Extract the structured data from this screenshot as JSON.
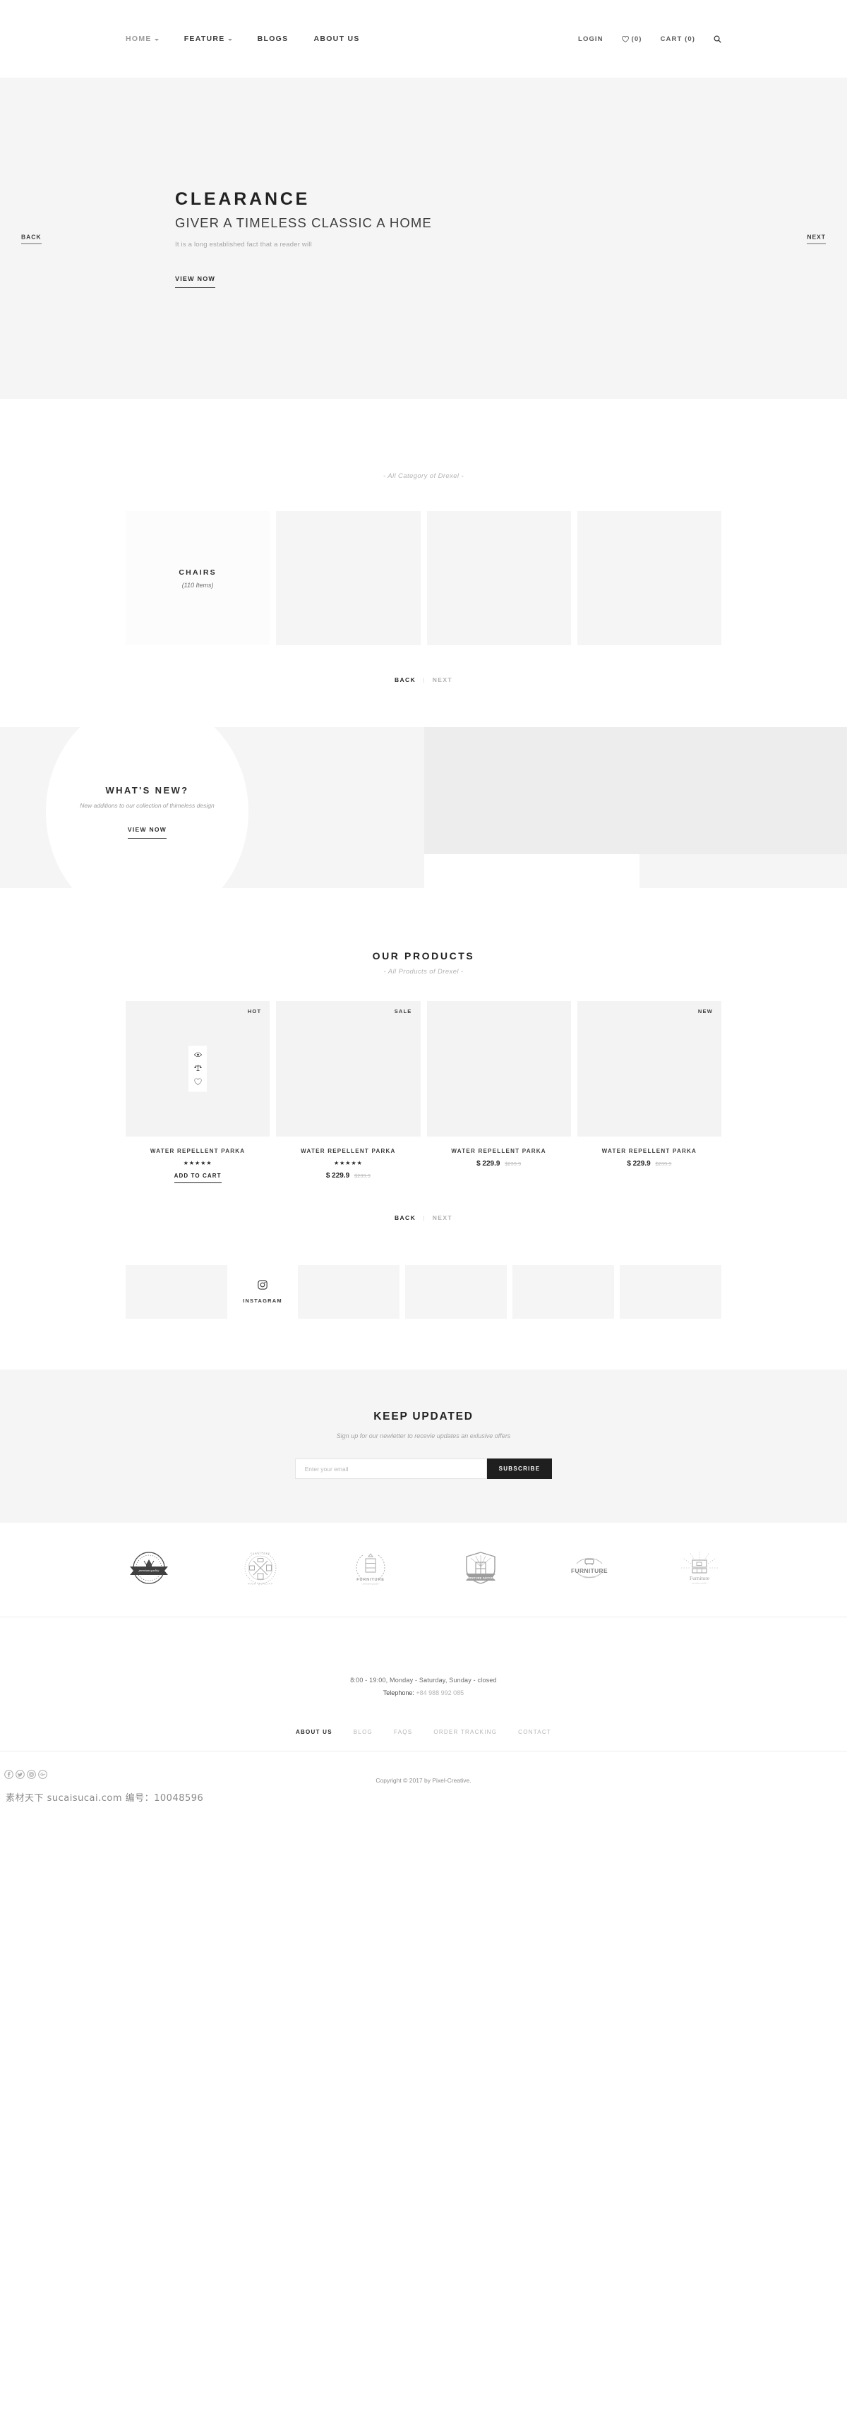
{
  "header": {
    "nav": [
      {
        "label": "HOME",
        "has_caret": true,
        "muted": true
      },
      {
        "label": "FEATURE",
        "has_caret": true,
        "muted": false
      },
      {
        "label": "BLOGS",
        "has_caret": false,
        "muted": false
      },
      {
        "label": "ABOUT US",
        "has_caret": false,
        "muted": false
      }
    ],
    "login_label": "LOGIN",
    "wishlist_count": "(0)",
    "cart_label": "CART (0)",
    "search_icon": "search-icon",
    "wishlist_icon": "heart-icon"
  },
  "hero": {
    "title": "CLEARANCE",
    "subtitle": "GIVER A TIMELESS CLASSIC A HOME",
    "description": "It is a long established fact that a reader will",
    "cta": "VIEW NOW",
    "back": "BACK",
    "next": "NEXT"
  },
  "categories": {
    "eyebrow": "- All Category of Drexel -",
    "cards": [
      {
        "name": "CHAIRS",
        "count": "(110 Items)",
        "active": true
      },
      {
        "name": "",
        "count": "",
        "active": false
      },
      {
        "name": "",
        "count": "",
        "active": false
      },
      {
        "name": "",
        "count": "",
        "active": false
      }
    ],
    "pager": {
      "back": "BACK",
      "sep": "|",
      "next": "NEXT"
    }
  },
  "whats_new": {
    "title": "WHAT'S NEW?",
    "subtitle": "New additions to our collection of thimeless design",
    "cta": "VIEW NOW"
  },
  "products": {
    "title": "OUR PRODUCTS",
    "eyebrow": "- All Products of Drexel -",
    "items": [
      {
        "badge": "HOT",
        "name": "WATER REPELLENT PARKA",
        "stars": "★★★★★",
        "price": "",
        "price_old": "",
        "add_to_cart": "ADD TO CART",
        "show_actions": true,
        "actions": [
          "eye-icon",
          "compare-icon",
          "heart-icon"
        ]
      },
      {
        "badge": "SALE",
        "name": "WATER REPELLENT PARKA",
        "stars": "★★★★★",
        "price": "$ 229.9",
        "price_old": "$239.9",
        "add_to_cart": "",
        "show_actions": false,
        "actions": []
      },
      {
        "badge": "",
        "name": "WATER REPELLENT PARKA",
        "stars": "",
        "price": "$ 229.9",
        "price_old": "$239.9",
        "add_to_cart": "",
        "show_actions": false,
        "actions": []
      },
      {
        "badge": "NEW",
        "name": "WATER REPELLENT PARKA",
        "stars": "",
        "price": "$ 229.9",
        "price_old": "$239.9",
        "add_to_cart": "",
        "show_actions": false,
        "actions": []
      }
    ],
    "pager": {
      "back": "BACK",
      "sep": "|",
      "next": "NEXT"
    }
  },
  "instagram": {
    "label": "INSTAGRAM",
    "icon": "instagram-icon",
    "tiles": 5
  },
  "newsletter": {
    "title": "KEEP UPDATED",
    "subtitle": "Sign up for our newletter to recevie updates an exlusive offers",
    "placeholder": "Enter your email",
    "value": "",
    "button": "SUBSCRIBE"
  },
  "brands": [
    {
      "name": "brand-premium-quality-badge"
    },
    {
      "name": "brand-furniture-high-quality-badge"
    },
    {
      "name": "brand-furniture-premium-quality-wreath"
    },
    {
      "name": "brand-furniture-factory-shield"
    },
    {
      "name": "brand-furniture-high-quality-circle"
    },
    {
      "name": "brand-furniture-premium-quality-sunburst"
    }
  ],
  "footer": {
    "hours": "8:00 - 19:00, Monday - Saturday, Sunday - closed",
    "telephone_label": "Telephone:",
    "telephone_number": "+84 988 992 085",
    "links": [
      {
        "label": "ABOUT US",
        "active": true
      },
      {
        "label": "BLOG",
        "active": false
      },
      {
        "label": "FAQS",
        "active": false
      },
      {
        "label": "ORDER TRACKING",
        "active": false
      },
      {
        "label": "CONTACT",
        "active": false
      }
    ],
    "copyright": "Copyright © 2017 by Pixel-Creative."
  },
  "watermark": "素材天下 sucaisucai.com  编号：10048596",
  "colors": {
    "page_bg": "#ffffff",
    "panel_bg": "#f5f5f5",
    "tile_bg": "#ededed",
    "accent_dark": "#1f1f1f",
    "muted_text": "#b0b0b0"
  }
}
